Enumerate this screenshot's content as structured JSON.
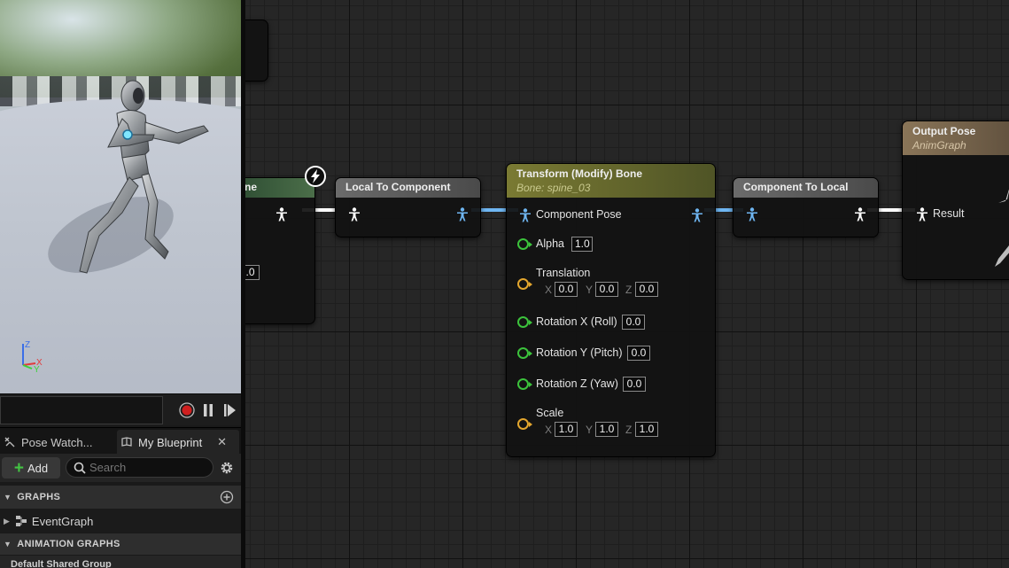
{
  "viewport": {
    "axis_labels": {
      "z": "Z",
      "x": "X",
      "y": "Y"
    }
  },
  "timeline": {
    "buttons": [
      "record-icon",
      "pause-icon",
      "step-forward-icon"
    ]
  },
  "tabs": {
    "pose_watch": "Pose Watch...",
    "my_blueprint": "My Blueprint",
    "close": "✕"
  },
  "toolbar": {
    "add_label": "Add",
    "search_placeholder": "Search"
  },
  "sections": {
    "graphs": "GRAPHS",
    "event_graph": "EventGraph",
    "animation_graphs": "ANIMATION GRAPHS",
    "default_shared_group": "Default Shared Group"
  },
  "graph": {
    "left_node": {
      "title_fragment": "ne",
      "value_fragment": ".0"
    },
    "local_to_component": {
      "title": "Local To Component"
    },
    "transform_bone": {
      "title": "Transform (Modify) Bone",
      "subtitle": "Bone: spine_03",
      "component_pose": "Component Pose",
      "alpha": {
        "label": "Alpha",
        "value": "1.0"
      },
      "translation": {
        "label": "Translation",
        "x": "0.0",
        "y": "0.0",
        "z": "0.0"
      },
      "rotation_x": {
        "label": "Rotation X (Roll)",
        "value": "0.0"
      },
      "rotation_y": {
        "label": "Rotation Y (Pitch)",
        "value": "0.0"
      },
      "rotation_z": {
        "label": "Rotation Z (Yaw)",
        "value": "0.0"
      },
      "scale": {
        "label": "Scale",
        "x": "1.0",
        "y": "1.0",
        "z": "1.0"
      },
      "axis_letters": {
        "x": "X",
        "y": "Y",
        "z": "Z"
      }
    },
    "component_to_local": {
      "title": "Component To Local"
    },
    "output_pose": {
      "title": "Output Pose",
      "subtitle": "AnimGraph",
      "result": "Result"
    }
  },
  "colors": {
    "graph_bg": "#262626",
    "pose_wire_white": "#ffffff",
    "pose_wire_blue": "#6fb6f2",
    "float_pin": "#3cc33c",
    "vector_pin": "#e3a62e",
    "transform_header": "#7a7a33",
    "output_header": "#8a7558"
  }
}
